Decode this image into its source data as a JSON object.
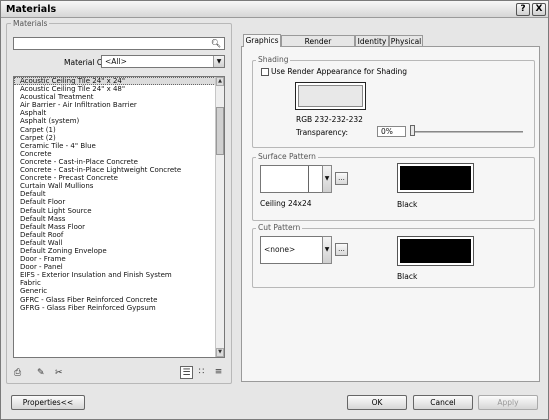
{
  "window": {
    "title": "Materials",
    "help_label": "?",
    "close_label": "X"
  },
  "left": {
    "group_label": "Materials",
    "search_value": "",
    "class_label": "Material Class:",
    "class_value": "<All>",
    "materials": [
      "Acoustic Ceiling Tile 24\" x 24\"",
      "Acoustic Ceiling Tile 24\" x 48\"",
      "Acoustical Treatment",
      "Air Barrier - Air Infiltration Barrier",
      "Asphalt",
      "Asphalt (system)",
      "Carpet (1)",
      "Carpet (2)",
      "Ceramic Tile - 4\" Blue",
      "Concrete",
      "Concrete - Cast-in-Place Concrete",
      "Concrete - Cast-in-Place Lightweight Concrete",
      "Concrete - Precast Concrete",
      "Curtain Wall Mullions",
      "Default",
      "Default Floor",
      "Default Light Source",
      "Default Mass",
      "Default Mass Floor",
      "Default Roof",
      "Default Wall",
      "Default Zoning Envelope",
      "Door - Frame",
      "Door - Panel",
      "EIFS - Exterior Insulation and Finish System",
      "Fabric",
      "Generic",
      "GFRC - Glass Fiber Reinforced Concrete",
      "GFRG - Glass Fiber Reinforced Gypsum"
    ],
    "selected_index": 0
  },
  "tabs": [
    "Graphics",
    "Render Appearance",
    "Identity",
    "Physical"
  ],
  "shading": {
    "label": "Shading",
    "checkbox_label": "Use Render Appearance for Shading",
    "rgb_text": "RGB 232-232-232",
    "transparency_label": "Transparency:",
    "transparency_value": "0%",
    "color": "#e8e8e8"
  },
  "surface_pattern": {
    "label": "Surface Pattern",
    "pattern_name": "Ceiling 24x24",
    "color_name": "Black",
    "color": "#000000",
    "more_label": "..."
  },
  "cut_pattern": {
    "label": "Cut Pattern",
    "pattern_value": "<none>",
    "color_name": "Black",
    "color": "#000000",
    "more_label": "..."
  },
  "footer": {
    "properties_label": "Properties<<",
    "ok_label": "OK",
    "cancel_label": "Cancel",
    "apply_label": "Apply"
  }
}
